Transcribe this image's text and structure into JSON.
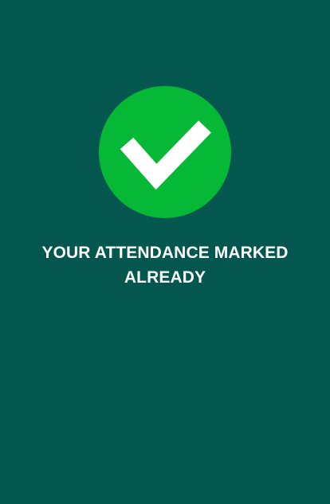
{
  "status": {
    "icon": "check-circle-icon",
    "message": "YOUR ATTENDANCE MARKED ALREADY"
  },
  "colors": {
    "background": "#03574f",
    "success": "#05b835",
    "text": "#ffffff"
  }
}
